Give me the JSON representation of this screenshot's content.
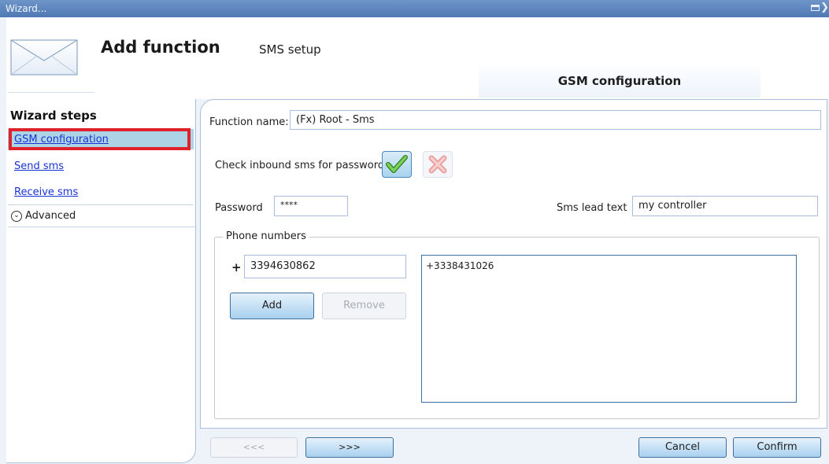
{
  "window": {
    "title": "Wizard..."
  },
  "header": {
    "title": "Add function",
    "subtitle": "SMS setup"
  },
  "step_tab": {
    "label": "GSM configuration"
  },
  "sidebar": {
    "title": "Wizard steps",
    "items": [
      {
        "label": "GSM configuration",
        "selected": true
      },
      {
        "label": "Send sms"
      },
      {
        "label": "Receive sms"
      }
    ],
    "advanced_label": "Advanced"
  },
  "form": {
    "function_name_label": "Function name:",
    "function_name_value": "(Fx) Root - Sms",
    "check_inbound_label": "Check inbound sms for password",
    "password_label": "Password",
    "password_value": "****",
    "lead_text_label": "Sms lead text",
    "lead_text_value": "my controller",
    "phone_group_label": "Phone numbers",
    "phone_prefix": "+",
    "phone_input_value": "3394630862",
    "add_label": "Add",
    "remove_label": "Remove",
    "phone_list": [
      "+3338431026"
    ]
  },
  "footer": {
    "back_label": "<<<",
    "next_label": ">>>",
    "cancel_label": "Cancel",
    "confirm_label": "Confirm"
  },
  "colors": {
    "highlight": "#e0202a",
    "accent": "#4f79b5",
    "selected_row": "#add3e6"
  },
  "icons": [
    "envelope-icon",
    "checkmark-icon",
    "cross-icon",
    "chevron-down-icon",
    "restore-icon",
    "close-icon"
  ]
}
